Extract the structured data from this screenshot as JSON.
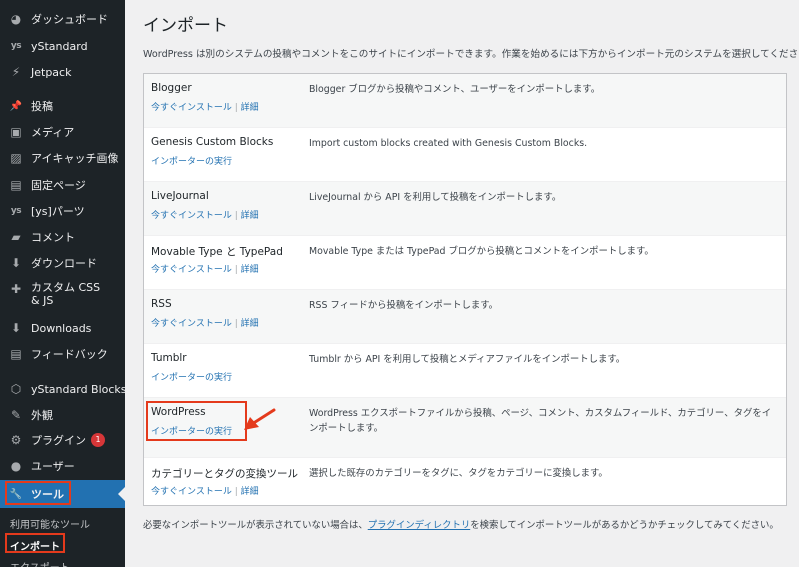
{
  "sidebar": {
    "items": [
      {
        "label": "ダッシュボード",
        "icon": "dashboard-icon",
        "glyph": "◕"
      },
      {
        "label": "yStandard",
        "icon": "ystandard-icon",
        "glyph": "ys"
      },
      {
        "label": "Jetpack",
        "icon": "jetpack-icon",
        "glyph": "⚡"
      },
      {
        "label": "投稿",
        "icon": "pin-icon",
        "glyph": "📌"
      },
      {
        "label": "メディア",
        "icon": "media-icon",
        "glyph": "▣"
      },
      {
        "label": "アイキャッチ画像",
        "icon": "featured-image-icon",
        "glyph": "▨"
      },
      {
        "label": "固定ページ",
        "icon": "page-icon",
        "glyph": "▤"
      },
      {
        "label": "[ys]パーツ",
        "icon": "ys-parts-icon",
        "glyph": "ys"
      },
      {
        "label": "コメント",
        "icon": "comment-icon",
        "glyph": "▰"
      },
      {
        "label": "ダウンロード",
        "icon": "download-icon",
        "glyph": "⬇"
      },
      {
        "label": "カスタム CSS & JS",
        "icon": "custom-css-icon",
        "glyph": "✚"
      },
      {
        "label": "Downloads",
        "icon": "downloads-icon",
        "glyph": "⬇"
      },
      {
        "label": "フィードバック",
        "icon": "feedback-icon",
        "glyph": "▤"
      },
      {
        "label": "yStandard Blocks",
        "icon": "ystandard-blocks-icon",
        "glyph": "⬡"
      },
      {
        "label": "外観",
        "icon": "appearance-icon",
        "glyph": "✎"
      },
      {
        "label": "プラグイン",
        "icon": "plugin-icon",
        "glyph": "⚙",
        "badge": "1"
      },
      {
        "label": "ユーザー",
        "icon": "user-icon",
        "glyph": "●"
      },
      {
        "label": "ツール",
        "icon": "wrench-icon",
        "glyph": "🔧"
      }
    ],
    "submenu": [
      {
        "label": "利用可能なツール"
      },
      {
        "label": "インポート"
      },
      {
        "label": "エクスポート"
      }
    ]
  },
  "main": {
    "title": "インポート",
    "intro": "WordPress は別のシステムの投稿やコメントをこのサイトにインポートできます。作業を始めるには下方からインポート元のシステムを選択してください。",
    "importers": [
      {
        "name": "Blogger",
        "install": "今すぐインストール",
        "details": "詳細",
        "description": "Blogger ブログから投稿やコメント、ユーザーをインポートします。"
      },
      {
        "name": "Genesis Custom Blocks",
        "run": "インポーターの実行",
        "description": "Import custom blocks created with Genesis Custom Blocks."
      },
      {
        "name": "LiveJournal",
        "install": "今すぐインストール",
        "details": "詳細",
        "description": "LiveJournal から API を利用して投稿をインポートします。"
      },
      {
        "name": "Movable Type と TypePad",
        "install": "今すぐインストール",
        "details": "詳細",
        "description": "Movable Type または TypePad ブログから投稿とコメントをインポートします。"
      },
      {
        "name": "RSS",
        "install": "今すぐインストール",
        "details": "詳細",
        "description": "RSS フィードから投稿をインポートします。"
      },
      {
        "name": "Tumblr",
        "run": "インポーターの実行",
        "description": "Tumblr から API を利用して投稿とメディアファイルをインポートします。"
      },
      {
        "name": "WordPress",
        "run": "インポーターの実行",
        "description": "WordPress エクスポートファイルから投稿、ページ、コメント、カスタムフィールド、カテゴリー、タグをインポートします。"
      },
      {
        "name": "カテゴリーとタグの変換ツール",
        "install": "今すぐインストール",
        "details": "詳細",
        "description": "選択した既存のカテゴリーをタグに、タグをカテゴリーに変換します。"
      }
    ],
    "footer": {
      "before": "必要なインポートツールが表示されていない場合は、",
      "link": "プラグインディレクトリ",
      "after": "を検索してインポートツールがあるかどうかチェックしてみてください。"
    }
  },
  "colors": {
    "sidebar_bg": "#1d2327",
    "active": "#2271b1",
    "link": "#2271b1",
    "highlight": "#e43a1c",
    "badge": "#d63638"
  }
}
